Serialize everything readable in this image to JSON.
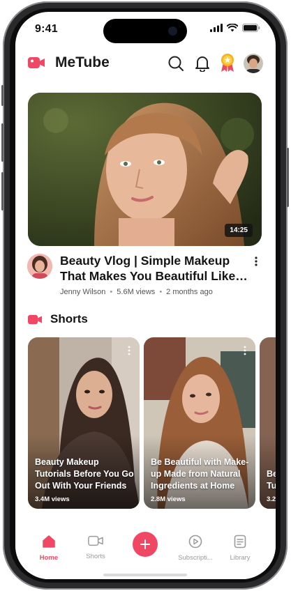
{
  "status": {
    "time": "9:41"
  },
  "header": {
    "title": "MeTube",
    "brand_color": "#f04864"
  },
  "featured_video": {
    "duration": "14:25",
    "title": "Beauty Vlog | Simple Makeup That Makes You Beautiful Like Never Before",
    "channel": "Jenny Wilson",
    "views": "5.6M views",
    "age": "2 months ago"
  },
  "shorts": {
    "heading": "Shorts",
    "items": [
      {
        "caption": "Beauty Makeup Tutorials Before You Go Out With Your Friends",
        "views": "3.4M views"
      },
      {
        "caption": "Be Beautiful with Make-up Made from Natural Ingredients at Home",
        "views": "2.8M views"
      },
      {
        "caption": "Be Tu",
        "views": "3.2"
      }
    ]
  },
  "nav": {
    "home": "Home",
    "shorts": "Shorts",
    "subscriptions": "Subscripti...",
    "library": "Library"
  },
  "icons": {
    "logo": "video-camera-icon",
    "search": "search-icon",
    "bell": "bell-icon",
    "badge": "award-badge-icon",
    "add": "plus-icon"
  }
}
